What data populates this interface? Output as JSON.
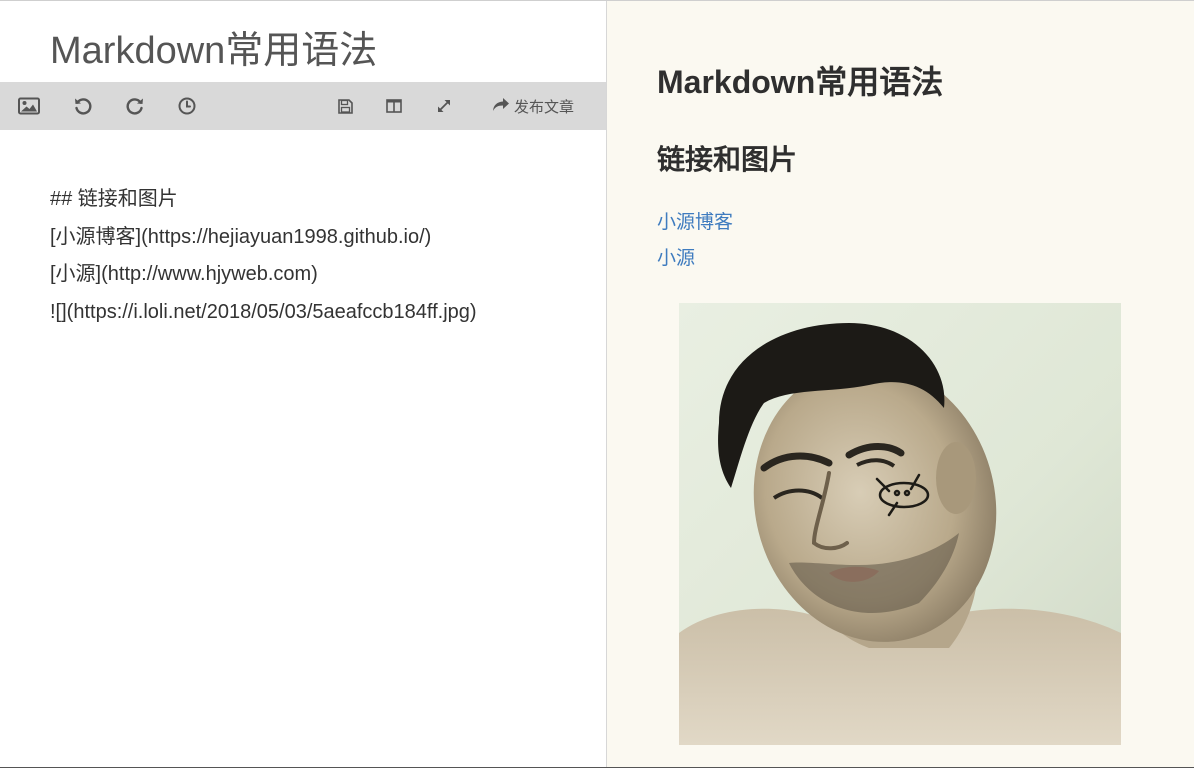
{
  "editor": {
    "title": "Markdown常用语法",
    "toolbar": {
      "publish_label": "发布文章",
      "buttons": [
        {
          "name": "insert-image",
          "icon": "image-icon"
        },
        {
          "name": "undo",
          "icon": "undo-icon"
        },
        {
          "name": "redo",
          "icon": "redo-icon"
        },
        {
          "name": "history",
          "icon": "clock-icon"
        },
        {
          "name": "save",
          "icon": "save-icon"
        },
        {
          "name": "split-view",
          "icon": "columns-icon"
        },
        {
          "name": "fullscreen",
          "icon": "expand-icon"
        },
        {
          "name": "publish",
          "icon": "share-arrow-icon"
        }
      ]
    },
    "lines": [
      "## 链接和图片",
      "[小源博客](https://hejiayuan1998.github.io/)",
      "[小源](http://www.hjyweb.com)",
      "![](https://i.loli.net/2018/05/03/5aeafccb184ff.jpg)"
    ]
  },
  "preview": {
    "h1": "Markdown常用语法",
    "h2": "链接和图片",
    "links": [
      {
        "text": "小源博客"
      },
      {
        "text": "小源"
      }
    ],
    "image": {
      "subject": "man-portrait-photo"
    }
  },
  "colors": {
    "toolbar_bg": "#d9d9d9",
    "preview_bg": "#fbf9f1",
    "link": "#3f7cbf",
    "heading": "#2f2f2f",
    "editor_text": "#333333"
  }
}
